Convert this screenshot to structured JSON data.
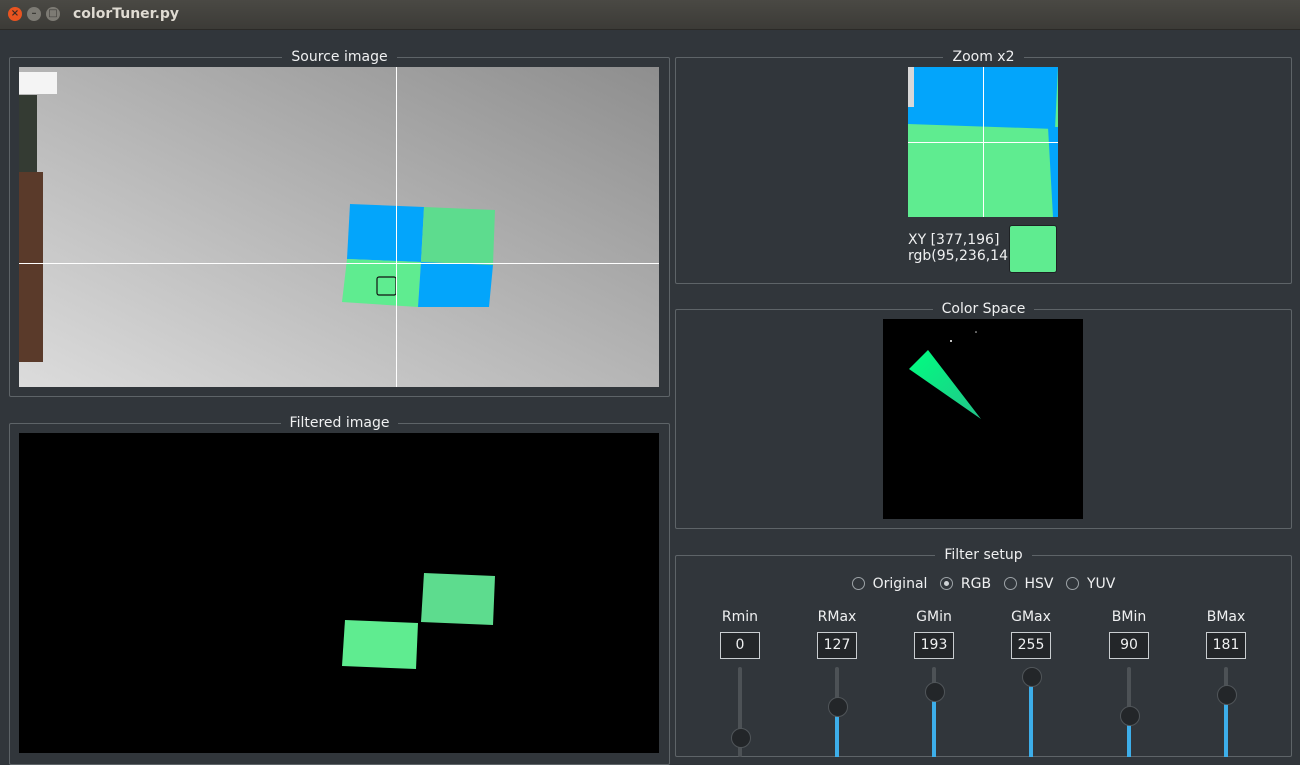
{
  "window": {
    "title": "colorTuner.py",
    "close_glyph": "×",
    "min_glyph": "–",
    "max_glyph": "□"
  },
  "source": {
    "title": "Source image"
  },
  "filtered": {
    "title": "Filtered image"
  },
  "zoom": {
    "title": "Zoom x2",
    "xy": "XY [377,196]",
    "rgb": "rgb(95,236,144)",
    "swatch_color": "#5fec90"
  },
  "color_space": {
    "title": "Color Space"
  },
  "filter_setup": {
    "title": "Filter setup",
    "modes": [
      {
        "label": "Original",
        "selected": false
      },
      {
        "label": "RGB",
        "selected": true
      },
      {
        "label": "HSV",
        "selected": false
      },
      {
        "label": "YUV",
        "selected": false
      }
    ],
    "channels": [
      {
        "label": "Rmin",
        "value": "0",
        "level": 0.0
      },
      {
        "label": "RMax",
        "value": "127",
        "level": 0.5
      },
      {
        "label": "GMin",
        "value": "193",
        "level": 0.757
      },
      {
        "label": "GMax",
        "value": "255",
        "level": 1.0
      },
      {
        "label": "BMin",
        "value": "90",
        "level": 0.353
      },
      {
        "label": "BMax",
        "value": "181",
        "level": 0.71
      }
    ]
  },
  "colors": {
    "accent": "#3daee9",
    "background": "#31363b",
    "patch_blue": "#03a5fb",
    "patch_green": "#5fec90"
  }
}
